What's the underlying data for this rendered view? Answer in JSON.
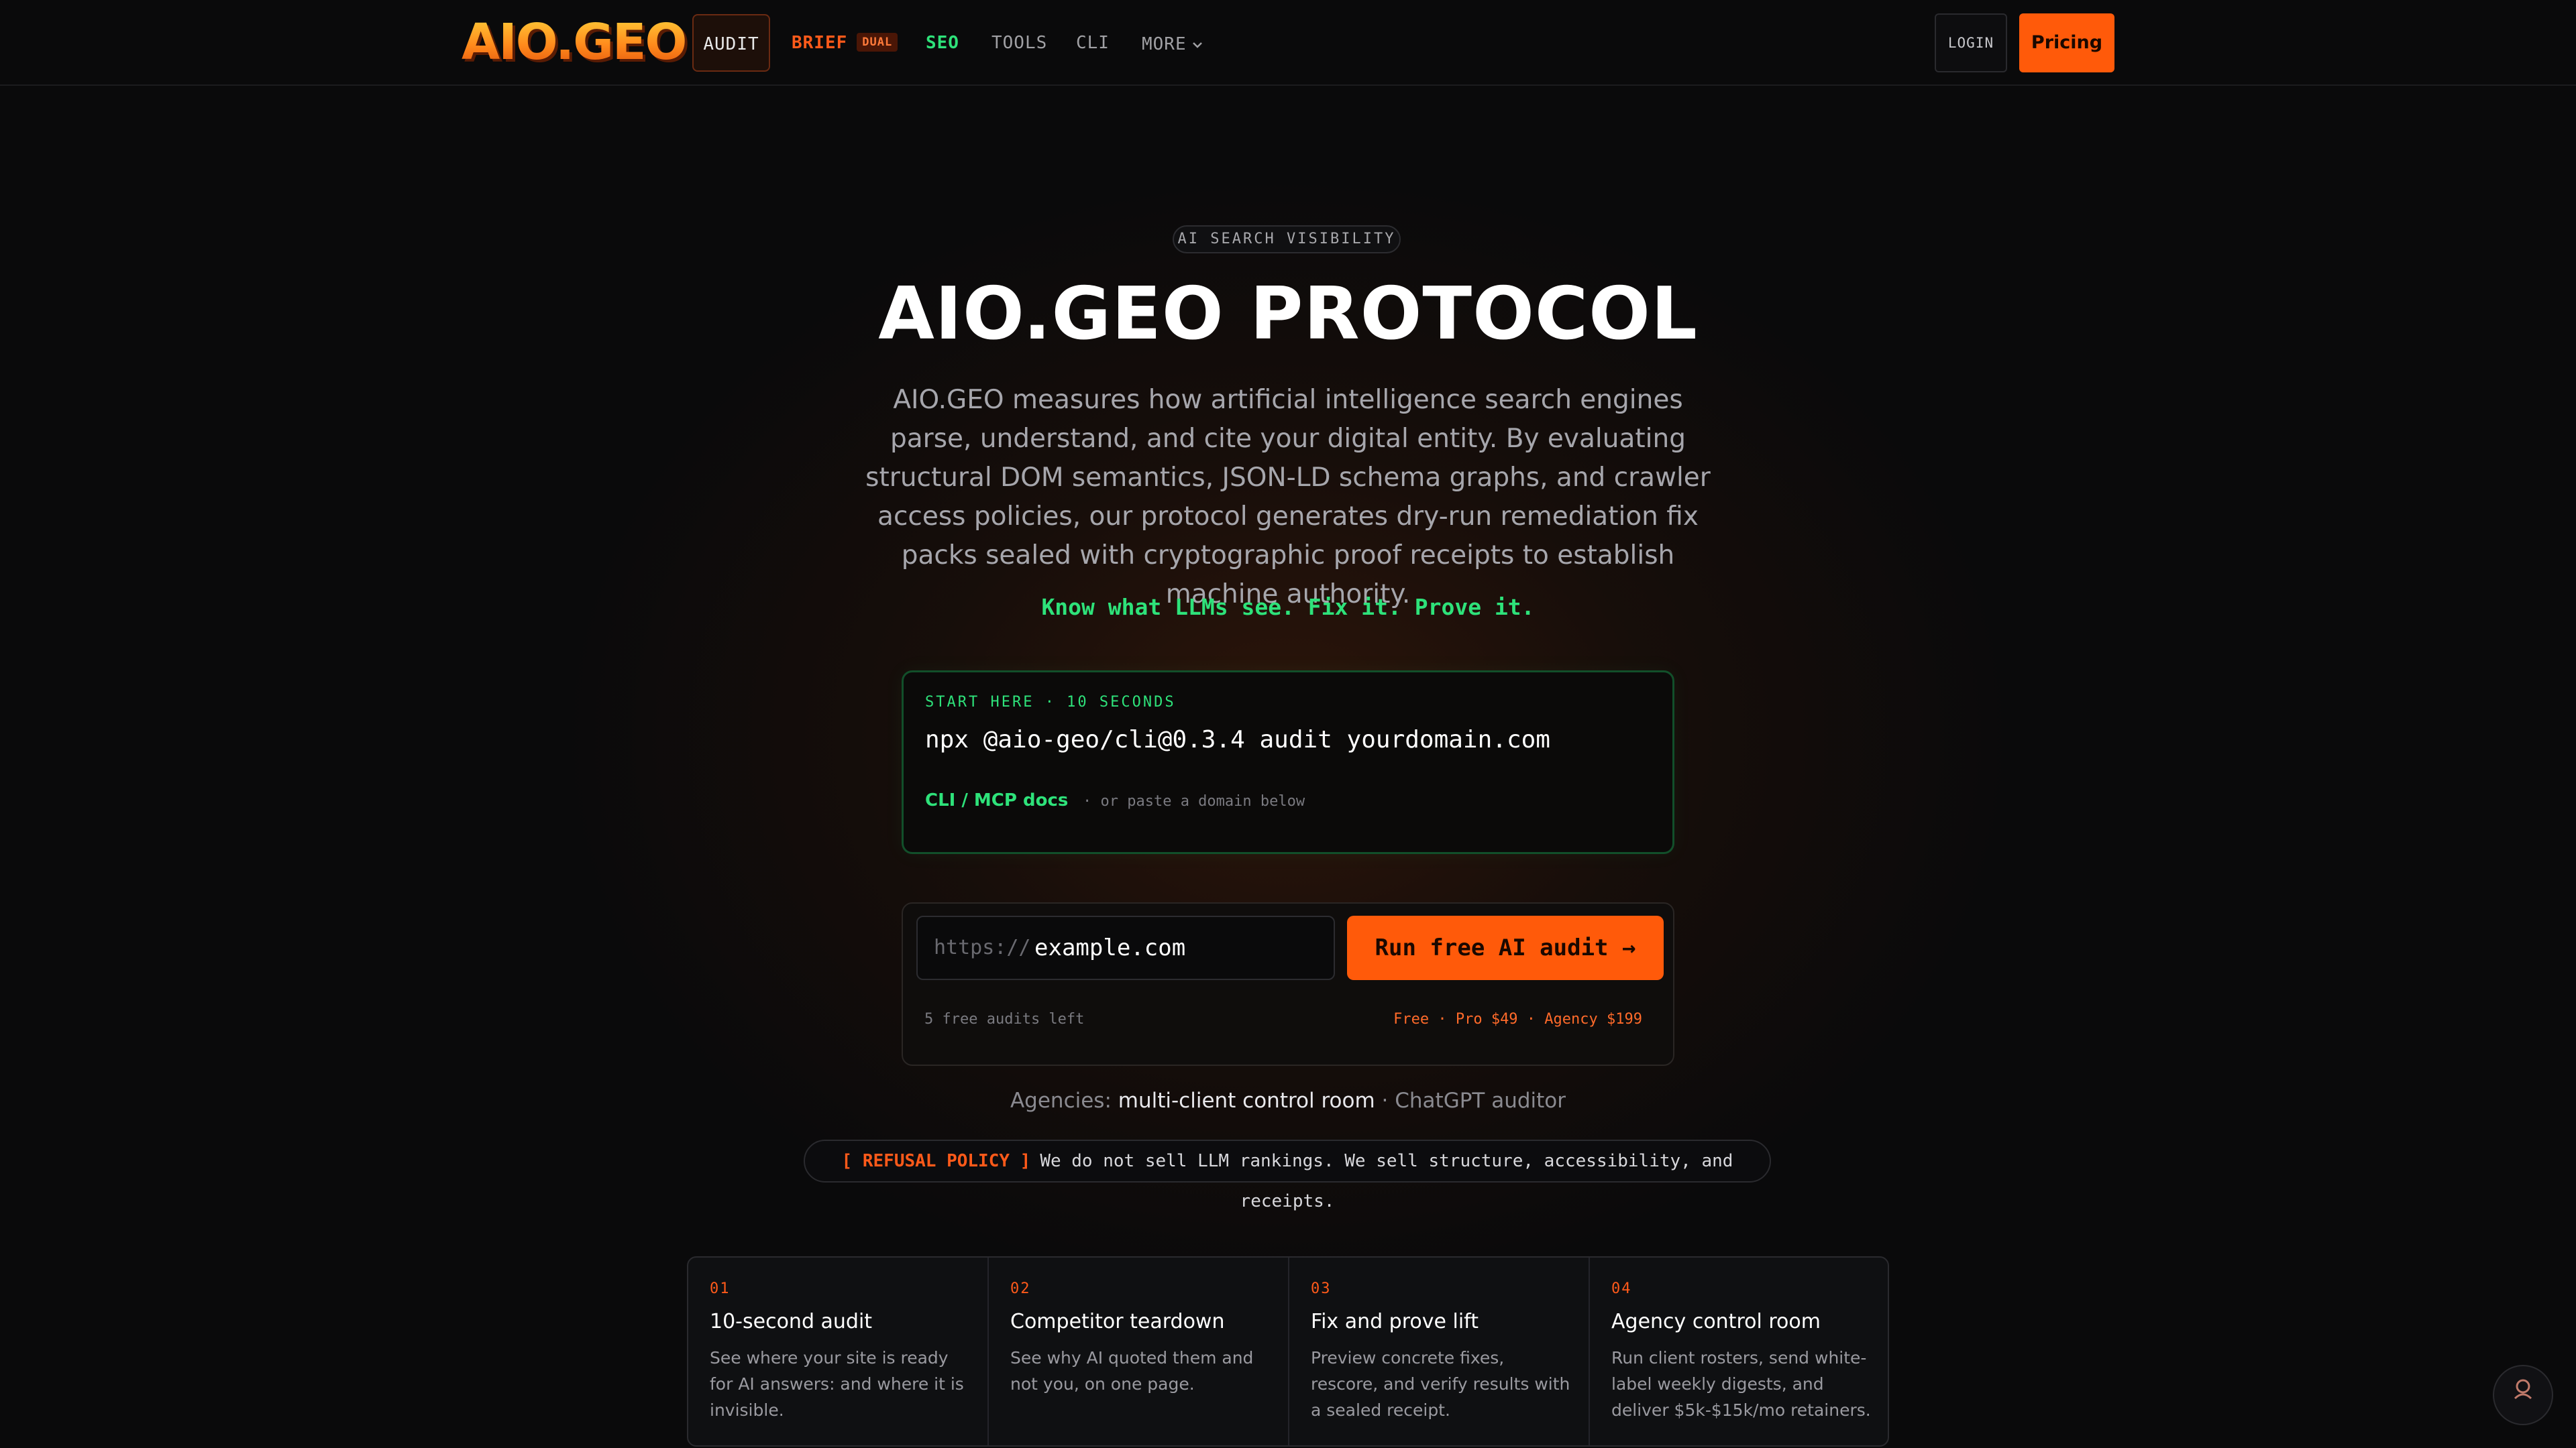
{
  "nav": {
    "logo": "AIO.GEO",
    "items": {
      "audit": "AUDIT",
      "brief": "BRIEF",
      "brief_badge": "DUAL",
      "seo": "SEO",
      "tools": "TOOLS",
      "cli": "CLI",
      "more": "MORE"
    },
    "login": "LOGIN",
    "pricing": "Pricing"
  },
  "hero": {
    "eyebrow": "AI SEARCH VISIBILITY",
    "title": "AIO.GEO PROTOCOL",
    "lead": "AIO.GEO measures how artificial intelligence search engines parse, understand, and cite your digital entity. By evaluating structural DOM semantics, JSON-LD schema graphs, and crawler access policies, our protocol generates dry-run remediation fix packs sealed with cryptographic proof receipts to establish machine authority.",
    "tagline": "Know what LLMs see. Fix it. Prove it."
  },
  "cli": {
    "label": "START HERE · 10 SECONDS",
    "command": "npx @aio-geo/cli@0.3.4 audit yourdomain.com",
    "docs_link": "CLI / MCP docs",
    "or_text": "· or paste a domain below"
  },
  "audit_form": {
    "prefix": "https://",
    "value": "example.com",
    "run_button": "Run free AI audit →",
    "audits_left": "5 free audits left",
    "plans": "Free · Pro $49 · Agency $199"
  },
  "agencies": {
    "lead": "Agencies:",
    "link": "multi-client control room",
    "sep": "·",
    "tail": "ChatGPT auditor"
  },
  "refusal": {
    "tag": "[ REFUSAL POLICY ]",
    "text": "We do not sell LLM rankings. We sell structure, accessibility, and receipts."
  },
  "features": [
    {
      "num": "01",
      "title": "10-second audit",
      "desc": "See where your site is ready for AI answers: and where it is invisible."
    },
    {
      "num": "02",
      "title": "Competitor teardown",
      "desc": "See why AI quoted them and not you, on one page."
    },
    {
      "num": "03",
      "title": "Fix and prove lift",
      "desc": "Preview concrete fixes, rescore, and verify results with a sealed receipt."
    },
    {
      "num": "04",
      "title": "Agency control room",
      "desc": "Run client rosters, send white-label weekly digests, and deliver $5k-$15k/mo retainers."
    }
  ],
  "icons": {
    "chevron": "chevron-down-icon",
    "arrow": "arrow-right-icon",
    "chat": "chat-assistant-icon"
  },
  "colors": {
    "accent": "#ff5a0a",
    "green": "#2ee27a",
    "background": "#0a0a0b"
  }
}
